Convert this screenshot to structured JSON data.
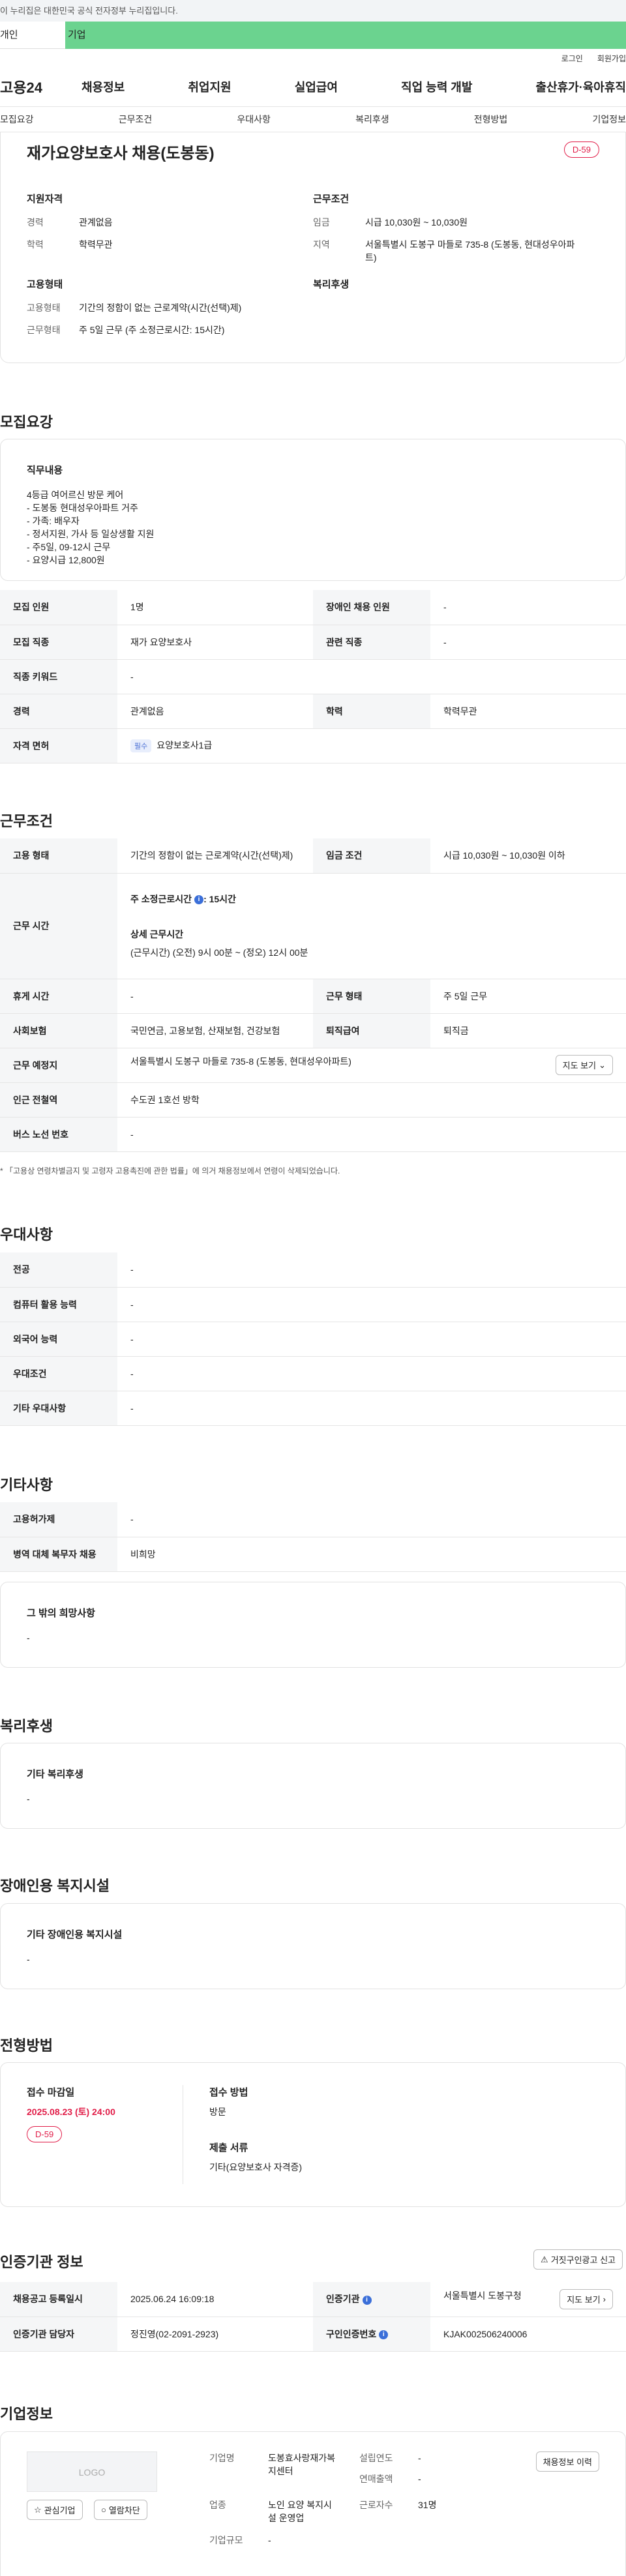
{
  "notice": "이 누리집은 대한민국 공식 전자정부 누리집입니다.",
  "tabs": {
    "t1": "개인",
    "t2": "기업"
  },
  "util": {
    "login": "로그인",
    "join": "회원가입"
  },
  "gnb": {
    "logo": "고용24",
    "menu": [
      "채용정보",
      "취업지원",
      "실업급여",
      "직업 능력 개발",
      "출산휴가·육아휴직"
    ]
  },
  "subnav": [
    "모집요강",
    "근무조건",
    "우대사항",
    "복리후생",
    "전형방법",
    "기업정보"
  ],
  "summary": {
    "title": "재가요양보호사 채용(도봉동)",
    "dday": "D-59",
    "qual_title": "지원자격",
    "qual": [
      {
        "k": "경력",
        "v": "관계없음"
      },
      {
        "k": "학력",
        "v": "학력무관"
      }
    ],
    "cond_title": "근무조건",
    "cond": [
      {
        "k": "임금",
        "v": "시급 10,030원 ~ 10,030원"
      },
      {
        "k": "지역",
        "v": "서울특별시 도봉구 마들로 735-8 (도봉동, 현대성우아파트)"
      }
    ],
    "emp_title": "고용형태",
    "emp": [
      {
        "k": "고용형태",
        "v": "기간의 정함이 없는 근로계약(시간(선택)제)"
      },
      {
        "k": "근무형태",
        "v": "주 5일 근무 (주 소정근로시간: 15시간)"
      }
    ],
    "welfare_title": "복리후생"
  },
  "recruit": {
    "title": "모집요강",
    "duty_h": "직무내용",
    "duty": "4등급 여어르신 방문 케어\n- 도봉동 현대성우아파트 거주\n- 가족: 배우자\n- 정서지원, 가사 등 일상생활 지원\n- 주5일, 09-12시 근무\n- 요양시급 12,800원",
    "rows": [
      [
        "모집 인원",
        "1명",
        "장애인 채용 인원",
        "-"
      ],
      [
        "모집 직종",
        "재가 요양보호사",
        "관련 직종",
        "-"
      ]
    ],
    "keyword": [
      "직종 키워드",
      "-"
    ],
    "career": [
      "경력",
      "관계없음",
      "학력",
      "학력무관"
    ],
    "license": {
      "k": "자격 면허",
      "badge": "필수",
      "v": "요양보호사1급"
    }
  },
  "work": {
    "title": "근무조건",
    "type": [
      "고용 형태",
      "기간의 정함이 없는 근로계약(시간(선택)제)",
      "임금 조건",
      "시급 10,030원 ~ 10,030원 이하"
    ],
    "hours_k": "근무 시간",
    "hours_a": "주 소정근로시간",
    "hours_av": ": 15시간",
    "hours_b": "상세 근무시간",
    "hours_bv": "(근무시간) (오전) 9시 00분 ~ (정오) 12시 00분",
    "rest": [
      "휴게 시간",
      "-",
      "근무 형태",
      "주 5일 근무"
    ],
    "ins": [
      "사회보험",
      "국민연금, 고용보험, 산재보험, 건강보험",
      "퇴직급여",
      "퇴직금"
    ],
    "place_k": "근무 예정지",
    "place_v": "서울특별시 도봉구 마들로 735-8 (도봉동, 현대성우아파트)",
    "map": "지도 보기",
    "station": [
      "인근 전철역",
      "수도권 1호선 방학"
    ],
    "bus": [
      "버스 노선 번호",
      "-"
    ],
    "note": "* 「고용상 연령차별금지 및 고령자 고용촉진에 관한 법률」에 의거 채용정보에서 연령이 삭제되었습니다."
  },
  "pref": {
    "title": "우대사항",
    "rows": [
      [
        "전공",
        "-"
      ],
      [
        "컴퓨터 활용 능력",
        "-"
      ],
      [
        "외국어 능력",
        "-"
      ],
      [
        "우대조건",
        "-"
      ],
      [
        "기타 우대사항",
        "-"
      ]
    ]
  },
  "etc": {
    "title": "기타사항",
    "rows": [
      [
        "고용허가제",
        "-"
      ],
      [
        "병역 대체 복무자 채용",
        "비희망"
      ]
    ],
    "wish_h": "그 밖의 희망사항",
    "wish": "-"
  },
  "welfare": {
    "title": "복리후생",
    "h": "기타 복리후생",
    "v": "-"
  },
  "disab": {
    "title": "장애인용 복지시설",
    "h": "기타 장애인용 복지시설",
    "v": "-"
  },
  "process": {
    "title": "전형방법",
    "deadline_h": "접수 마감일",
    "deadline": "2025.08.23 (토) 24:00",
    "dday": "D-59",
    "method_h": "접수 방법",
    "method": "방문",
    "docs_h": "제출 서류",
    "docs": "기타(요양보호사 자격증)"
  },
  "cert": {
    "title": "인증기관 정보",
    "report": "거짓구인광고 신고",
    "rows": [
      [
        "채용공고 등록일시",
        "2025.06.24 16:09:18",
        "인증기관",
        "서울특별시 도봉구청"
      ],
      [
        "인증기관 담당자",
        "정진영(02-2091-2923)",
        "구인인증번호",
        "KJAK002506240006"
      ]
    ],
    "map": "지도 보기"
  },
  "company": {
    "title": "기업정보",
    "logo": "LOGO",
    "fav": "관심기업",
    "block": "열람차단",
    "name_k": "기업명",
    "name": "도봉효사랑재가복지센터",
    "year_k": "설립연도",
    "year": "-",
    "sales_k": "연매출액",
    "sales": "-",
    "ind_k": "업종",
    "ind": "노인 요양 복지시설 운영업",
    "emp_k": "근로자수",
    "emp": "31명",
    "size_k": "기업규모",
    "size": "-",
    "history": "채용정보 이력"
  }
}
